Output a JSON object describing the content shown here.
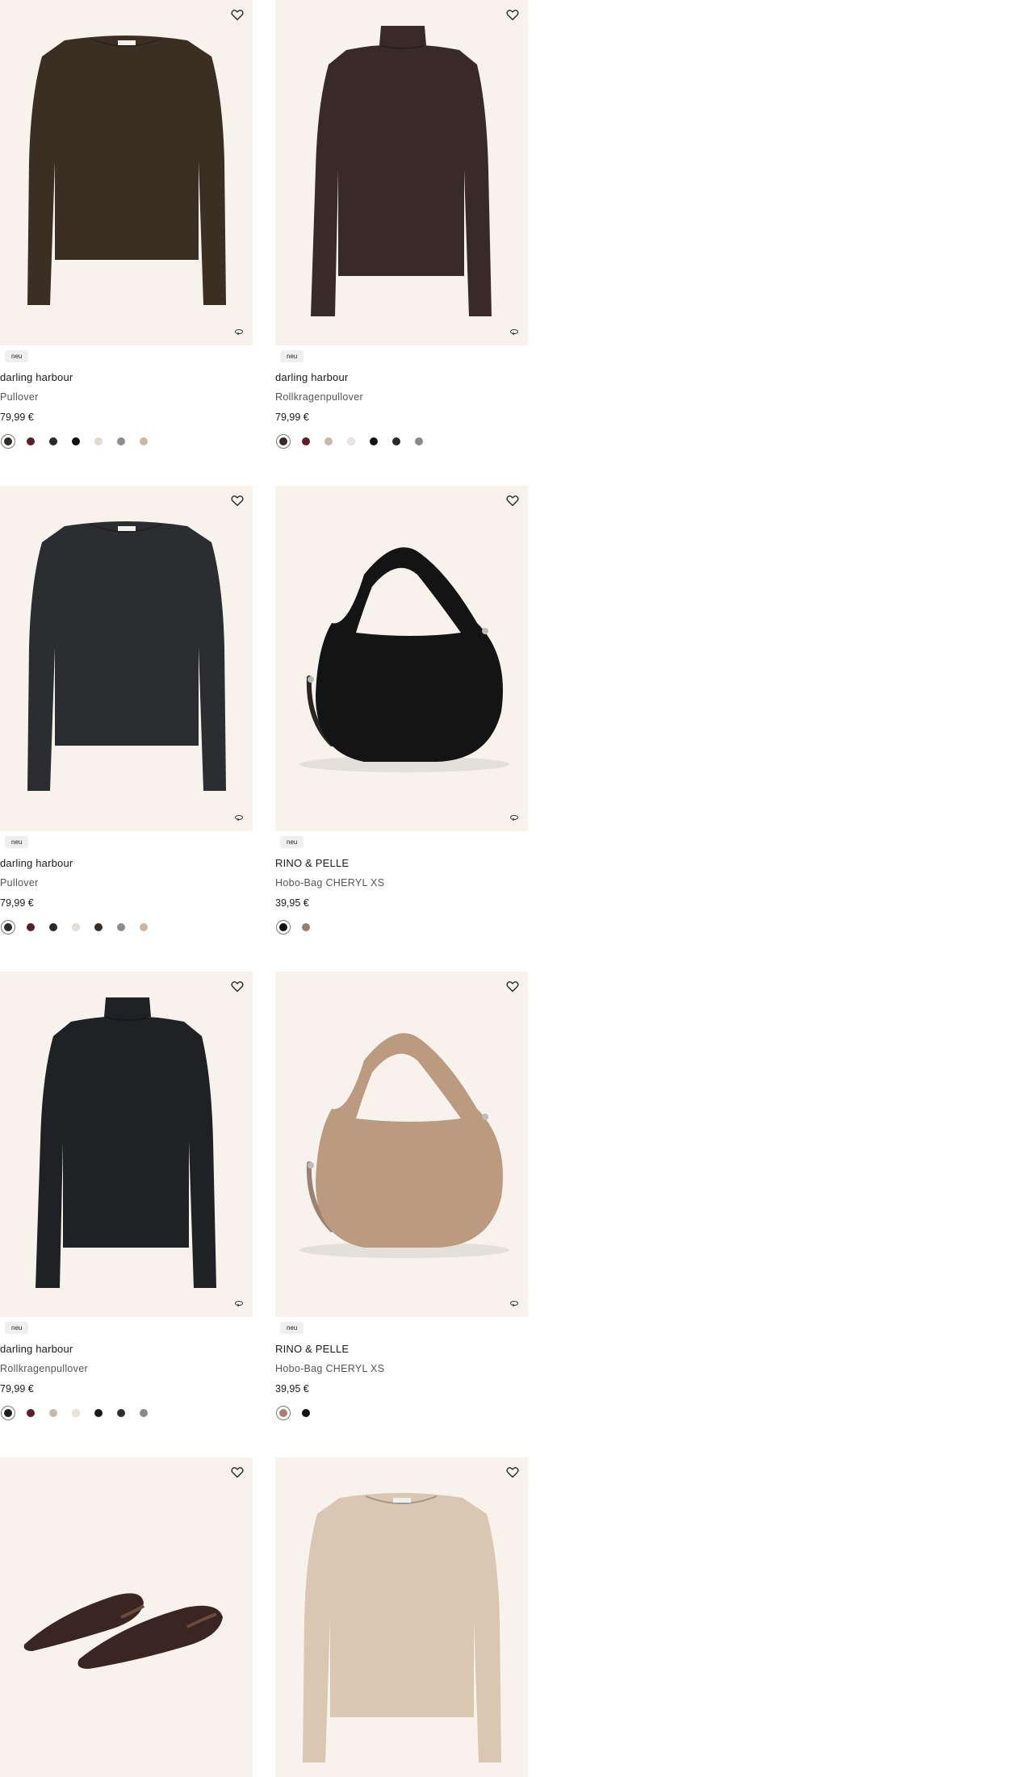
{
  "products": [
    {
      "badge": "neu",
      "brand": "darling harbour",
      "name": "Pullover",
      "price": "79,99 €",
      "image": "crewneck-sweater",
      "image_color": "#3b2f24",
      "swatches": [
        "#2e2a26",
        "#5a1f2a",
        "#2a2a2a",
        "#111111",
        "#e2d8cb",
        "#8d8d8d",
        "#cdb7a3"
      ]
    },
    {
      "badge": "neu",
      "brand": "darling harbour",
      "name": "Rollkragenpullover",
      "price": "79,99 €",
      "image": "turtleneck-sweater",
      "image_color": "#3a2a27",
      "swatches": [
        "#3a2a27",
        "#5a1f2a",
        "#c9b8a8",
        "#ece7dc",
        "#141414",
        "#2a2a2a",
        "#8a8a8a"
      ]
    },
    {
      "badge": "neu",
      "brand": "darling harbour",
      "name": "Pullover",
      "price": "79,99 €",
      "image": "crewneck-sweater",
      "image_color": "#2c2d30",
      "swatches": [
        "#2c2d30",
        "#5a1f2a",
        "#2a2a2a",
        "#e7ddd0",
        "#3b2d2a",
        "#8d8d8d",
        "#cdb7a3"
      ]
    },
    {
      "badge": "neu",
      "brand": "RINO & PELLE",
      "name": "Hobo-Bag CHERYL XS",
      "price": "39,95 €",
      "image": "fur-hobo-bag",
      "image_color": "#141414",
      "swatches": [
        "#111111",
        "#9a7d6b"
      ]
    },
    {
      "badge": "neu",
      "brand": "darling harbour",
      "name": "Rollkragenpullover",
      "price": "79,99 €",
      "image": "turtleneck-sweater",
      "image_color": "#1f2124",
      "swatches": [
        "#1f2124",
        "#5a1f2a",
        "#c9b8a8",
        "#ece3d6",
        "#1a1a1a",
        "#2e2e30",
        "#8a8a8a"
      ]
    },
    {
      "badge": "neu",
      "brand": "RINO & PELLE",
      "name": "Hobo-Bag CHERYL XS",
      "price": "39,95 €",
      "image": "fur-hobo-bag",
      "image_color": "#bb9a80",
      "swatches": [
        "#a47f73",
        "#111111"
      ]
    },
    {
      "badge": "",
      "brand": "",
      "name": "",
      "price": "",
      "image": "loafers",
      "image_color": "#3a2620",
      "swatches": []
    },
    {
      "badge": "",
      "brand": "",
      "name": "",
      "price": "",
      "image": "crewneck-sweater",
      "image_color": "#d9c7b2",
      "swatches": []
    }
  ]
}
